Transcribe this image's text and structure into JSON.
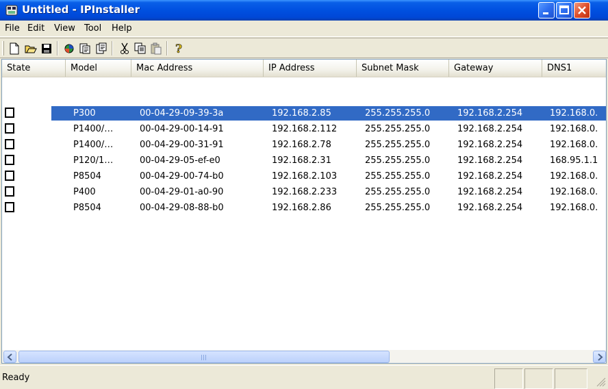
{
  "window": {
    "title": "Untitled - IPInstaller",
    "controls": [
      "minimize",
      "maximize",
      "close"
    ]
  },
  "menu": [
    "File",
    "Edit",
    "View",
    "Tool",
    "Help"
  ],
  "toolbar": {
    "buttons": [
      "new-icon",
      "open-icon",
      "save-icon",
      "search-devices-icon",
      "download-icon",
      "upload-icon",
      "cut-icon",
      "copy-icon",
      "paste-icon",
      "help-icon"
    ]
  },
  "table": {
    "columns": [
      "State",
      "Model",
      "Mac Address",
      "IP Address",
      "Subnet Mask",
      "Gateway",
      "DNS1"
    ],
    "rows": [
      {
        "model": "P300",
        "mac": "00-04-29-09-39-3a",
        "ip": "192.168.2.85",
        "mask": "255.255.255.0",
        "gateway": "192.168.2.254",
        "dns1": "192.168.0.",
        "selected": true
      },
      {
        "model": "P1400/…",
        "mac": "00-04-29-00-14-91",
        "ip": "192.168.2.112",
        "mask": "255.255.255.0",
        "gateway": "192.168.2.254",
        "dns1": "192.168.0.",
        "selected": false
      },
      {
        "model": "P1400/…",
        "mac": "00-04-29-00-31-91",
        "ip": "192.168.2.78",
        "mask": "255.255.255.0",
        "gateway": "192.168.2.254",
        "dns1": "192.168.0.",
        "selected": false
      },
      {
        "model": "P120/1…",
        "mac": "00-04-29-05-ef-e0",
        "ip": "192.168.2.31",
        "mask": "255.255.255.0",
        "gateway": "192.168.2.254",
        "dns1": "168.95.1.1",
        "selected": false
      },
      {
        "model": "P8504",
        "mac": "00-04-29-00-74-b0",
        "ip": "192.168.2.103",
        "mask": "255.255.255.0",
        "gateway": "192.168.2.254",
        "dns1": "192.168.0.",
        "selected": false
      },
      {
        "model": "P400",
        "mac": "00-04-29-01-a0-90",
        "ip": "192.168.2.233",
        "mask": "255.255.255.0",
        "gateway": "192.168.2.254",
        "dns1": "192.168.0.",
        "selected": false
      },
      {
        "model": "P8504",
        "mac": "00-04-29-08-88-b0",
        "ip": "192.168.2.86",
        "mask": "255.255.255.0",
        "gateway": "192.168.2.254",
        "dns1": "192.168.0.",
        "selected": false
      }
    ]
  },
  "status": {
    "text": "Ready"
  },
  "colors": {
    "titlebar": "#0050e0",
    "selection": "#316ac5",
    "window_bg": "#ece9d8"
  }
}
